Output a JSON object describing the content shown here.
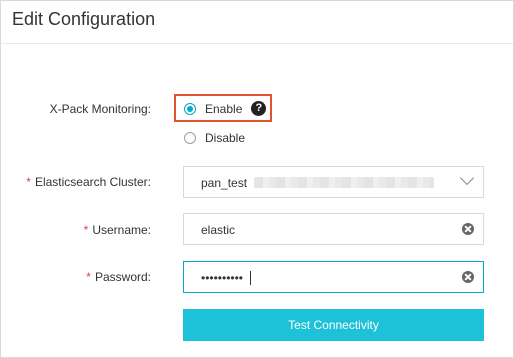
{
  "dialog": {
    "title": "Edit Configuration"
  },
  "xpack": {
    "label": "X-Pack Monitoring:",
    "options": [
      {
        "label": "Enable",
        "checked": true
      },
      {
        "label": "Disable",
        "checked": false
      }
    ],
    "help_icon": "question-circle-icon",
    "help_glyph": "?"
  },
  "cluster": {
    "required_mark": "*",
    "label": "Elasticsearch Cluster:",
    "value": "pan_test",
    "icon": "chevron-down-icon"
  },
  "username": {
    "required_mark": "*",
    "label": "Username:",
    "value": "elastic",
    "icon": "clear-icon"
  },
  "password": {
    "required_mark": "*",
    "label": "Password:",
    "value": "••••••••••",
    "icon": "clear-icon"
  },
  "actions": {
    "test_label": "Test Connectivity"
  },
  "colors": {
    "accent": "#00aacc",
    "button": "#1ec2d8",
    "highlight": "#e0542f",
    "required": "#e4393c"
  }
}
